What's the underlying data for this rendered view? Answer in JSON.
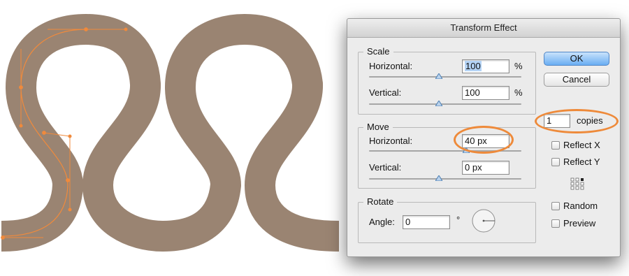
{
  "dialog": {
    "title": "Transform Effect",
    "scale": {
      "legend": "Scale",
      "horizontal_label": "Horizontal:",
      "horizontal_value": "100",
      "horizontal_unit": "%",
      "vertical_label": "Vertical:",
      "vertical_value": "100",
      "vertical_unit": "%"
    },
    "move": {
      "legend": "Move",
      "horizontal_label": "Horizontal:",
      "horizontal_value": "40 px",
      "vertical_label": "Vertical:",
      "vertical_value": "0 px"
    },
    "rotate": {
      "legend": "Rotate",
      "angle_label": "Angle:",
      "angle_value": "0",
      "degree_symbol": "°"
    },
    "buttons": {
      "ok": "OK",
      "cancel": "Cancel"
    },
    "copies": {
      "value": "1",
      "label": "copies"
    },
    "options": {
      "reflect_x": "Reflect X",
      "reflect_y": "Reflect Y",
      "random": "Random",
      "preview": "Preview"
    }
  },
  "colors": {
    "artwork_stroke": "#9a8472",
    "anchor_path": "#f08a3c",
    "highlight_ring": "#ee8a3a",
    "default_button": "#6aaef3"
  }
}
